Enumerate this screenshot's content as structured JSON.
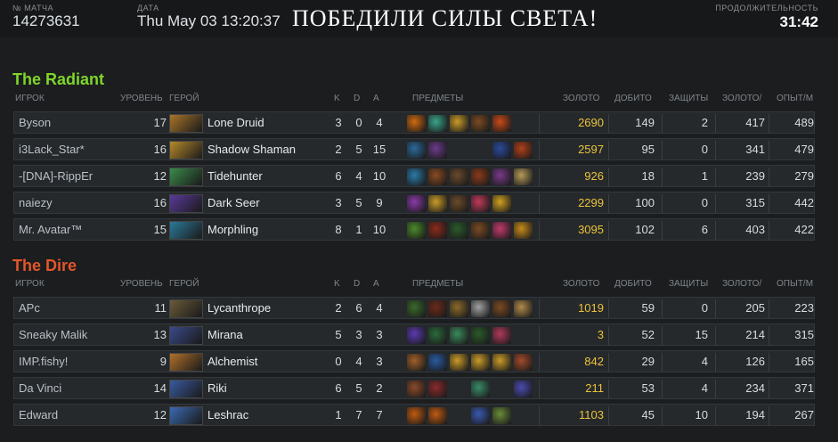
{
  "header": {
    "match_label": "№ МАТЧА",
    "match_id": "14273631",
    "date_label": "ДАТА",
    "date_value": "Thu May 03 13:20:37",
    "result": "ПОБЕДИЛИ СИЛЫ СВЕТА!",
    "duration_label": "ПРОДОЛЖИТЕЛЬНОСТЬ",
    "duration_value": "31:42"
  },
  "columns": {
    "player": "ИГРОК",
    "level": "УРОВЕНЬ",
    "hero": "ГЕРОЙ",
    "k": "K",
    "d": "D",
    "a": "A",
    "items": "ПРЕДМЕТЫ",
    "gold": "ЗОЛОТО",
    "last_hits": "ДОБИТО",
    "denies": "ЗАЩИТЫ",
    "gpm": "ЗОЛОТО/",
    "xpm": "ОПЫТ/М"
  },
  "colors": {
    "radiant": "#7fd62a",
    "dire": "#e4562a",
    "gold": "#ecc23a"
  },
  "radiant": {
    "title": "The Radiant",
    "players": [
      {
        "name": "Byson",
        "level": "17",
        "hero": "Lone Druid",
        "hero_color": "#a9742a",
        "k": "3",
        "d": "0",
        "a": "4",
        "items": [
          "#d06a10",
          "#3aa48a",
          "#c99a28",
          "#7a4a22",
          "#c84a18",
          "#000000"
        ],
        "gold": "2690",
        "lh": "149",
        "dn": "2",
        "gpm": "417",
        "xpm": "489"
      },
      {
        "name": "i3Lack_Star*",
        "level": "16",
        "hero": "Shadow Shaman",
        "hero_color": "#b58a2a",
        "k": "2",
        "d": "5",
        "a": "15",
        "items": [
          "#2a6a9a",
          "#6a3a8a",
          "#000000",
          "#000000",
          "#2a4a9a",
          "#b0401a"
        ],
        "gold": "2597",
        "lh": "95",
        "dn": "0",
        "gpm": "341",
        "xpm": "479"
      },
      {
        "name": "-[DNA]-RippEr",
        "level": "12",
        "hero": "Tidehunter",
        "hero_color": "#3a8a4a",
        "k": "6",
        "d": "4",
        "a": "10",
        "items": [
          "#2a7aa8",
          "#8a4a22",
          "#6a4a2a",
          "#8a3a1a",
          "#7a3a8a",
          "#b59a58"
        ],
        "gold": "926",
        "lh": "18",
        "dn": "1",
        "gpm": "239",
        "xpm": "279"
      },
      {
        "name": "naiezy",
        "level": "16",
        "hero": "Dark Seer",
        "hero_color": "#5a3a9a",
        "k": "3",
        "d": "5",
        "a": "9",
        "items": [
          "#8a3aa8",
          "#c99a28",
          "#6a4a2a",
          "#c03a5a",
          "#d0a020",
          "#000000"
        ],
        "gold": "2299",
        "lh": "100",
        "dn": "0",
        "gpm": "315",
        "xpm": "442"
      },
      {
        "name": "Mr. Avatar™",
        "level": "15",
        "hero": "Morphling",
        "hero_color": "#2a7a9a",
        "k": "8",
        "d": "1",
        "a": "10",
        "items": [
          "#4a8a2a",
          "#8a2a1a",
          "#2a5a2a",
          "#7a4a22",
          "#c03a6a",
          "#c88a1a"
        ],
        "gold": "3095",
        "lh": "102",
        "dn": "6",
        "gpm": "403",
        "xpm": "422"
      }
    ]
  },
  "dire": {
    "title": "The Dire",
    "players": [
      {
        "name": "APc",
        "level": "11",
        "hero": "Lycanthrope",
        "hero_color": "#6a5a3a",
        "k": "2",
        "d": "6",
        "a": "4",
        "items": [
          "#3a6a2a",
          "#6a2a1a",
          "#8a6a2a",
          "#a0a0a0",
          "#7a4a22",
          "#b08a4a"
        ],
        "gold": "1019",
        "lh": "59",
        "dn": "0",
        "gpm": "205",
        "xpm": "223"
      },
      {
        "name": "Sneaky Malik",
        "level": "13",
        "hero": "Mirana",
        "hero_color": "#3a4a8a",
        "k": "5",
        "d": "3",
        "a": "3",
        "items": [
          "#5a3ab0",
          "#2a6a3a",
          "#3a8a5a",
          "#2a5a2a",
          "#b03a5a",
          "#000000"
        ],
        "gold": "3",
        "lh": "52",
        "dn": "15",
        "gpm": "214",
        "xpm": "315"
      },
      {
        "name": "IMP.fishy!",
        "level": "9",
        "hero": "Alchemist",
        "hero_color": "#b0702a",
        "k": "0",
        "d": "4",
        "a": "3",
        "items": [
          "#a0602a",
          "#2a5aa0",
          "#c99a28",
          "#c99a28",
          "#c99a28",
          "#a04a2a"
        ],
        "gold": "842",
        "lh": "29",
        "dn": "4",
        "gpm": "126",
        "xpm": "165"
      },
      {
        "name": "Da Vinci",
        "level": "14",
        "hero": "Riki",
        "hero_color": "#3a5aa0",
        "k": "6",
        "d": "5",
        "a": "2",
        "items": [
          "#8a4a2a",
          "#8a2a2a",
          "#000000",
          "#3a8a6a",
          "#000000",
          "#4a4ab0"
        ],
        "gold": "211",
        "lh": "53",
        "dn": "4",
        "gpm": "234",
        "xpm": "371"
      },
      {
        "name": "Edward",
        "level": "12",
        "hero": "Leshrac",
        "hero_color": "#3a6ab0",
        "k": "1",
        "d": "7",
        "a": "7",
        "items": [
          "#c05a10",
          "#c05a10",
          "#000000",
          "#3a5ab0",
          "#6a8a3a",
          "#000000"
        ],
        "gold": "1103",
        "lh": "45",
        "dn": "10",
        "gpm": "194",
        "xpm": "267"
      }
    ]
  }
}
